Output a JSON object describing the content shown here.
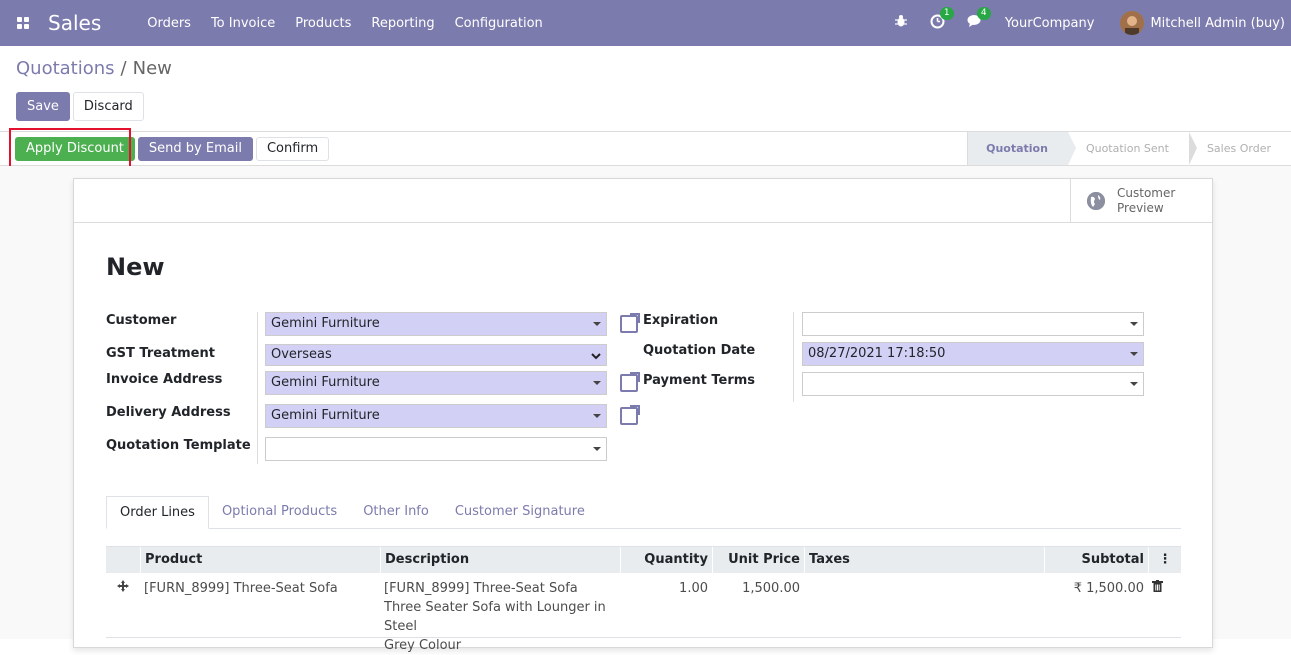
{
  "navbar": {
    "app_name": "Sales",
    "menu": [
      "Orders",
      "To Invoice",
      "Products",
      "Reporting",
      "Configuration"
    ],
    "activity_count": "1",
    "messages_count": "4",
    "company": "YourCompany",
    "user": "Mitchell Admin (buy)"
  },
  "breadcrumb": {
    "parent": "Quotations",
    "separator": "/",
    "current": "New"
  },
  "buttons": {
    "save": "Save",
    "discard": "Discard",
    "apply_discount": "Apply Discount",
    "send_email": "Send by Email",
    "confirm": "Confirm"
  },
  "stages": [
    "Quotation",
    "Quotation Sent",
    "Sales Order"
  ],
  "preview": {
    "line1": "Customer",
    "line2": "Preview"
  },
  "form": {
    "title": "New",
    "customer_label": "Customer",
    "customer_value": "Gemini Furniture",
    "gst_label": "GST Treatment",
    "gst_value": "Overseas",
    "invoice_label": "Invoice Address",
    "invoice_value": "Gemini Furniture",
    "delivery_label": "Delivery Address",
    "delivery_value": "Gemini Furniture",
    "template_label": "Quotation Template",
    "template_value": "",
    "expiration_label": "Expiration",
    "expiration_value": "",
    "date_label": "Quotation Date",
    "date_value": "08/27/2021 17:18:50",
    "terms_label": "Payment Terms",
    "terms_value": ""
  },
  "tabs": [
    "Order Lines",
    "Optional Products",
    "Other Info",
    "Customer Signature"
  ],
  "table": {
    "headers": [
      "Product",
      "Description",
      "Quantity",
      "Unit Price",
      "Taxes",
      "Subtotal"
    ],
    "rows": [
      {
        "product": "[FURN_8999] Three-Seat Sofa",
        "desc1": "[FURN_8999] Three-Seat Sofa",
        "desc2": "Three Seater Sofa with Lounger in Steel",
        "desc3": "Grey Colour",
        "qty": "1.00",
        "price": "1,500.00",
        "taxes": "",
        "subtotal": "₹ 1,500.00"
      }
    ]
  },
  "colors": {
    "primary": "#7c7bad",
    "success": "#4caf50",
    "highlight": "#e3112e"
  }
}
